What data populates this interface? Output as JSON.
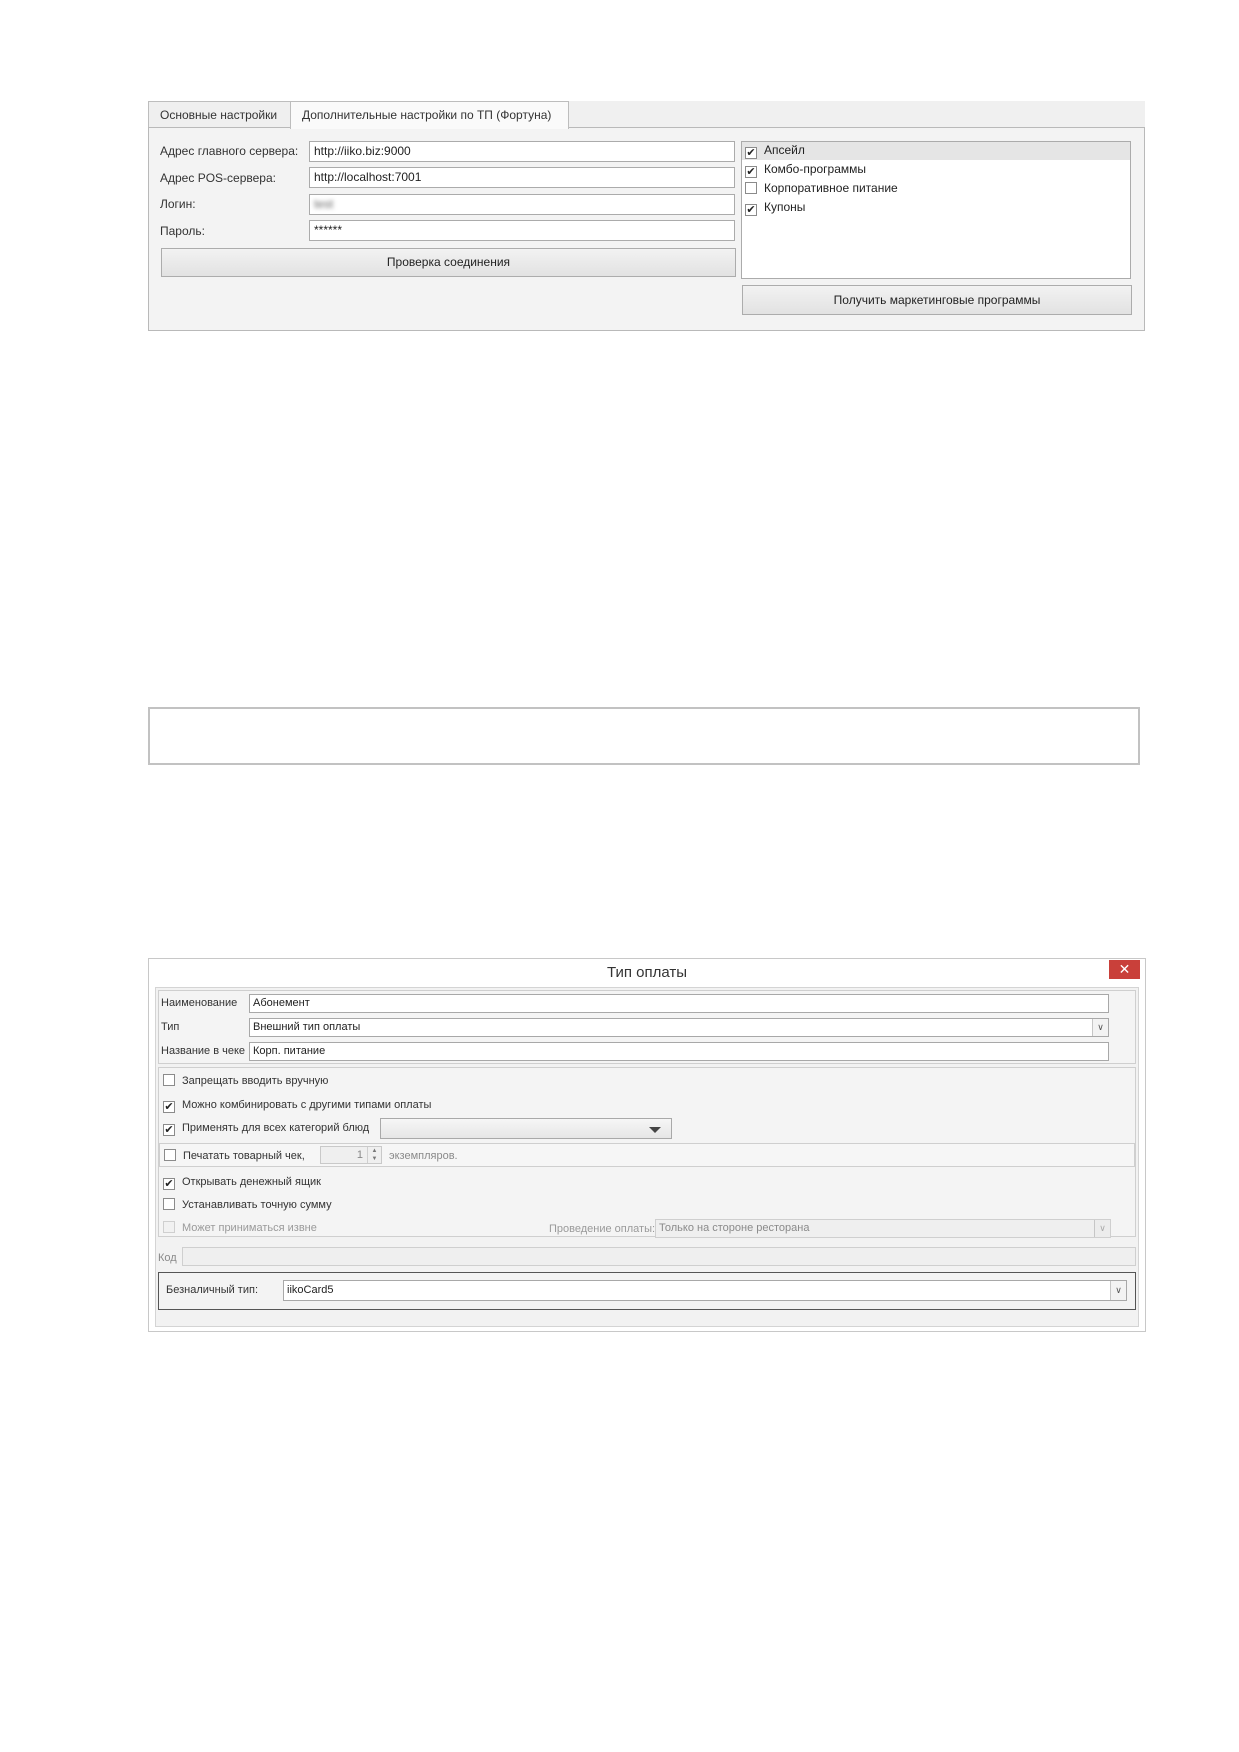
{
  "settings_panel": {
    "tabs": [
      {
        "label": "Основные настройки"
      },
      {
        "label": "Дополнительные настройки по ТП (Фортуна)"
      }
    ],
    "fields": [
      {
        "label": "Адрес главного сервера:",
        "value": "http://iiko.biz:9000"
      },
      {
        "label": "Адрес POS-сервера:",
        "value": "http://localhost:7001"
      },
      {
        "label": "Логин:",
        "value": "test"
      },
      {
        "label": "Пароль:",
        "value": "******"
      }
    ],
    "check_button": "Проверка соединения",
    "programs": [
      {
        "label": "Апсейл",
        "checked": true
      },
      {
        "label": "Комбо-программы",
        "checked": true
      },
      {
        "label": "Корпоративное питание",
        "checked": false
      },
      {
        "label": "Купоны",
        "checked": true
      }
    ],
    "get_programs_button": "Получить маркетинговые программы"
  },
  "payment_dialog": {
    "title": "Тип оплаты",
    "close_glyph": "✕",
    "name": {
      "label": "Наименование",
      "value": "Абонемент"
    },
    "type": {
      "label": "Тип",
      "value": "Внешний тип оплаты"
    },
    "receipt_name": {
      "label": "Название в чеке",
      "value": "Корп. питание"
    },
    "options": {
      "forbid_manual": {
        "label": "Запрещать вводить вручную",
        "checked": false
      },
      "combine": {
        "label": "Можно комбинировать с другими типами оплаты",
        "checked": true
      },
      "all_categories": {
        "label": "Применять для всех категорий блюд",
        "checked": true
      },
      "print_receipt": {
        "label": "Печатать товарный чек,",
        "checked": false,
        "copies": "1",
        "suffix": "экземпляров."
      },
      "open_drawer": {
        "label": "Открывать денежный ящик",
        "checked": true
      },
      "exact_sum": {
        "label": "Устанавливать точную сумму",
        "checked": false
      },
      "external": {
        "label": "Может приниматься извне",
        "checked": false
      }
    },
    "processing": {
      "label": "Проведение оплаты:",
      "value": "Только на стороне ресторана"
    },
    "code": {
      "label": "Код",
      "value": ""
    },
    "cashless": {
      "label": "Безналичный тип:",
      "value": "iikoCard5"
    }
  }
}
